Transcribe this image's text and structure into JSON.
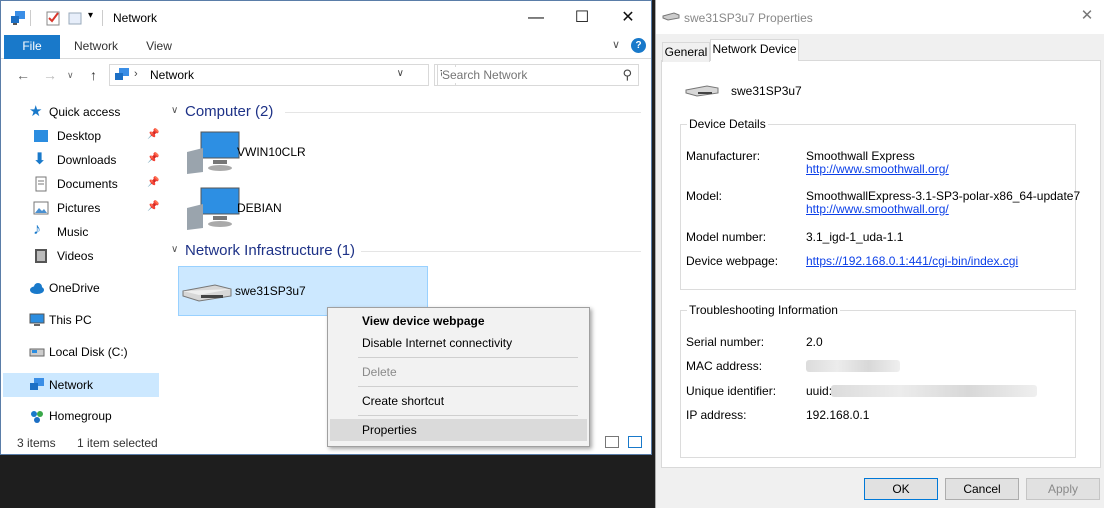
{
  "explorer": {
    "title": "Network",
    "ribbon": {
      "file": "File",
      "network": "Network",
      "view": "View"
    },
    "address": {
      "crumb": "Network",
      "search_placeholder": "Search Network"
    },
    "nav": {
      "quick_access": "Quick access",
      "items": [
        "Desktop",
        "Downloads",
        "Documents",
        "Pictures",
        "Music",
        "Videos"
      ],
      "onedrive": "OneDrive",
      "this_pc": "This PC",
      "local_disk": "Local Disk (C:)",
      "network": "Network",
      "homegroup": "Homegroup"
    },
    "groups": {
      "computer": "Computer (2)",
      "computers": [
        "VWIN10CLR",
        "DEBIAN"
      ],
      "infrastructure": "Network Infrastructure (1)",
      "device": "swe31SP3u7"
    },
    "status": {
      "count": "3 items",
      "selected": "1 item selected"
    }
  },
  "context_menu": {
    "view_webpage": "View device webpage",
    "disable": "Disable Internet connectivity",
    "delete": "Delete",
    "shortcut": "Create shortcut",
    "properties": "Properties"
  },
  "properties": {
    "title": "swe31SP3u7 Properties",
    "tabs": {
      "general": "General",
      "device": "Network Device"
    },
    "device_name": "swe31SP3u7",
    "details": {
      "legend": "Device Details",
      "manufacturer_label": "Manufacturer:",
      "manufacturer": "Smoothwall Express",
      "manufacturer_url": "http://www.smoothwall.org/",
      "model_label": "Model:",
      "model": "SmoothwallExpress-3.1-SP3-polar-x86_64-update7",
      "model_url": "http://www.smoothwall.org/",
      "model_number_label": "Model number:",
      "model_number": "3.1_igd-1_uda-1.1",
      "webpage_label": "Device webpage:",
      "webpage": "https://192.168.0.1:441/cgi-bin/index.cgi"
    },
    "trouble": {
      "legend": "Troubleshooting Information",
      "serial_label": "Serial number:",
      "serial": "2.0",
      "mac_label": "MAC address:",
      "uid_label": "Unique identifier:",
      "uid_prefix": "uuid:",
      "ip_label": "IP address:",
      "ip": "192.168.0.1"
    },
    "buttons": {
      "ok": "OK",
      "cancel": "Cancel",
      "apply": "Apply"
    }
  }
}
